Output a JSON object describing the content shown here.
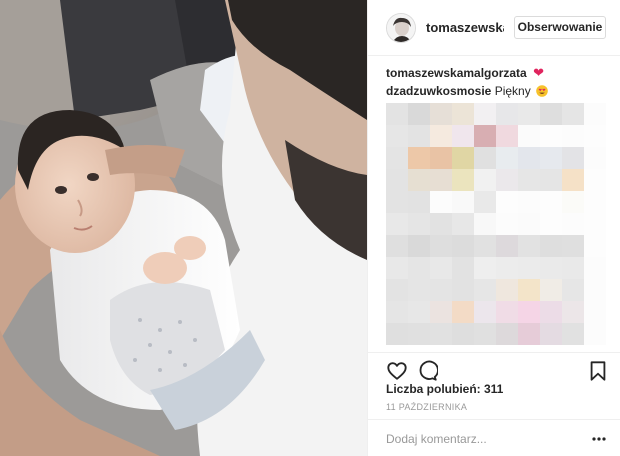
{
  "post": {
    "image_description_icon": "photo-icon"
  },
  "header": {
    "username": "tomaszewskar",
    "follow_label": "Obserwowanie"
  },
  "comments": [
    {
      "author": "tomaszewskamalgorzata",
      "text": "",
      "emoji": "heart"
    },
    {
      "author": "dzadzuwkosmosie",
      "text": "Piękny",
      "emoji": "heart-eyes"
    }
  ],
  "pixelated_block": {
    "colors": [
      "#e3e3e3",
      "#d9d9d9",
      "#e6dfd7",
      "#ece4d7",
      "#f2f0f2",
      "#e7e7e9",
      "#e9e9e9",
      "#dedede",
      "#e5e5e5",
      "#fcfcfc",
      "#e6e6e6",
      "#e3e3e3",
      "#f5eadf",
      "#f0e6ed",
      "#d8aeb2",
      "#f0d9df",
      "#fbfbfb",
      "#fdfdfd",
      "#fcfcfc",
      "#fdfdfd",
      "#e4e4e4",
      "#edc8a8",
      "#e9c3a5",
      "#e0d6a4",
      "#e0e0e0",
      "#e8ecef",
      "#e3e6ec",
      "#e6e9ee",
      "#e3e3e6",
      "#fcfcfc",
      "#e3e3e3",
      "#e6dfd2",
      "#e7ded3",
      "#ebe4be",
      "#f1f1f1",
      "#ebe8eb",
      "#e6e6e6",
      "#e5e5e5",
      "#f5e1c7",
      "#fdfdfd",
      "#e3e3e3",
      "#e2e2e2",
      "#fcfcfc",
      "#f9f9f9",
      "#e9e9e9",
      "#fdfdfd",
      "#fcfcfc",
      "#fdfdfd",
      "#fbfbf8",
      "#fdfdfd",
      "#e8e8e8",
      "#e5e5e5",
      "#e2e2e2",
      "#e7e7e7",
      "#f8f8f8",
      "#fcfcfc",
      "#fbfbfb",
      "#fdfdfd",
      "#fcfcfc",
      "#fdfdfd",
      "#dfdfdf",
      "#d9d9d9",
      "#dedede",
      "#dcdcdc",
      "#e1e1e1",
      "#ddd9dc",
      "#e2e2e2",
      "#dedede",
      "#dfdfdf",
      "#fdfdfd",
      "#e8e8e8",
      "#e5e5e5",
      "#e8e8e8",
      "#e2e2e2",
      "#eeeeee",
      "#ececec",
      "#ebebeb",
      "#eaeaea",
      "#e9e9e9",
      "#fcfcfc",
      "#e3e3e3",
      "#e5e5e5",
      "#e4e4e4",
      "#e2e2e2",
      "#e6e6e6",
      "#efe7de",
      "#f3e4c9",
      "#f0ece6",
      "#e6e6e6",
      "#fcfcfc",
      "#e5e5e5",
      "#e7e7e7",
      "#ebe3e0",
      "#f3dbc6",
      "#ece6ec",
      "#f0dce6",
      "#f5d5e6",
      "#ecdce7",
      "#ece6e8",
      "#fcfcfc",
      "#dfdfdf",
      "#e0e0e0",
      "#e1e1e1",
      "#dedede",
      "#e0e0e0",
      "#ddd9db",
      "#e6ccd8",
      "#e4dbe2",
      "#e1e1e1",
      "#fcfcfc"
    ]
  },
  "actions": {
    "like_icon": "heart-outline-icon",
    "comment_icon": "comment-bubble-icon",
    "save_icon": "bookmark-icon"
  },
  "likes": {
    "text": "Liczba polubień: 311"
  },
  "date": {
    "text": "11 PAŹDZIERNIKA"
  },
  "add_comment": {
    "placeholder": "Dodaj komentarz..."
  },
  "colors": {
    "border": "#efefef",
    "text": "#262626",
    "muted": "#999999",
    "heart": "#e0245e"
  }
}
